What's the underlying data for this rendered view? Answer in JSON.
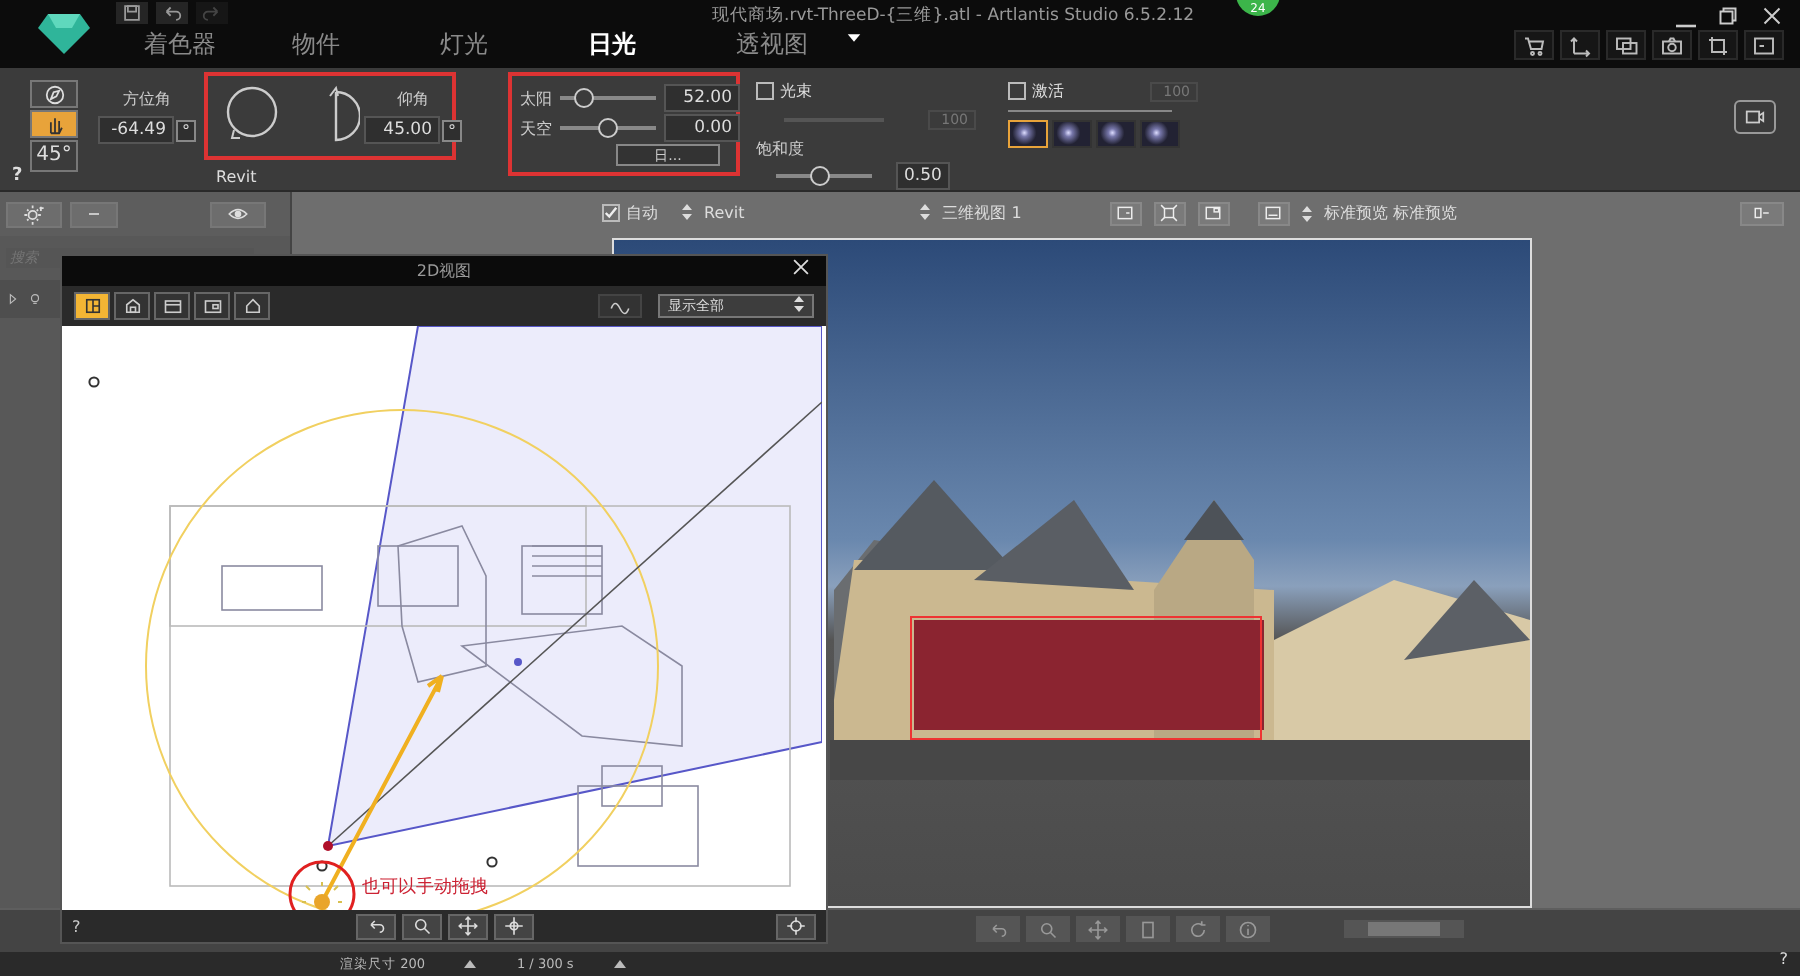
{
  "window": {
    "title": "现代商场.rvt-ThreeD-{三维}.atl - Artlantis Studio 6.5.2.12",
    "badge": "24"
  },
  "tabs": [
    {
      "label": "着色器",
      "selected": false
    },
    {
      "label": "物件",
      "selected": false
    },
    {
      "label": "灯光",
      "selected": false
    },
    {
      "label": "日光",
      "selected": true
    },
    {
      "label": "透视图",
      "selected": false
    }
  ],
  "sun_panel": {
    "preset": "45°",
    "azimuth_label": "方位角",
    "azimuth": "-64.49",
    "elevation_label": "仰角",
    "elevation": "45.00",
    "unit": "°",
    "source": "Revit",
    "help": "?"
  },
  "sliders": [
    {
      "label": "太阳",
      "level": 0.25,
      "value": "52.00"
    },
    {
      "label": "天空",
      "level": 0.5,
      "value": "0.00"
    }
  ],
  "sliders_button": "日...",
  "halo": {
    "label": "光束",
    "checked": false,
    "disabled": true,
    "value": "100"
  },
  "saturation": {
    "label": "饱和度",
    "level": 0.45,
    "value": "0.50"
  },
  "lens_flare": {
    "label": "激活",
    "checked": false,
    "disabled": true,
    "value": "100",
    "presets": [
      {
        "selected": true
      },
      {
        "selected": false
      },
      {
        "selected": false
      },
      {
        "selected": false
      }
    ]
  },
  "sidebar": {
    "search_placeholder": "搜索"
  },
  "viewport_toolbar": {
    "auto_label": "自动",
    "auto_checked": true,
    "source": "Revit",
    "view": "三维视图 1",
    "preset": "标准预览 标准预览"
  },
  "view2d": {
    "title": "2D视图",
    "tools": [
      {
        "selected": true
      },
      {
        "selected": false
      },
      {
        "selected": false
      },
      {
        "selected": false
      },
      {
        "selected": false
      }
    ],
    "display": "显示全部",
    "annotation": "也可以手动拖拽",
    "help": "?"
  },
  "status": {
    "size": "渲染尺寸 200",
    "time": "1 / 300 s",
    "help": "?"
  }
}
